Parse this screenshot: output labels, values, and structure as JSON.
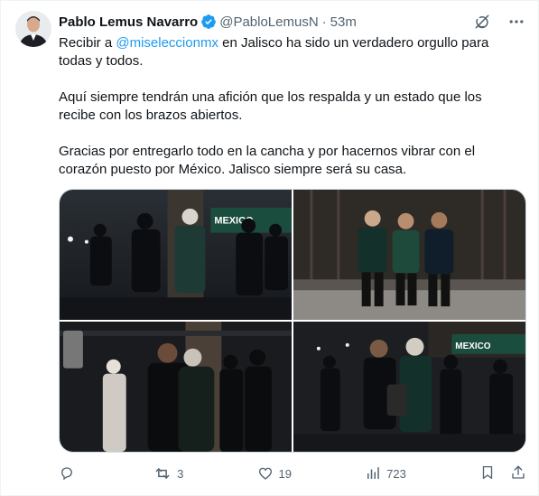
{
  "author": {
    "name": "Pablo Lemus Navarro",
    "handle": "@PabloLemusN",
    "separator": "·",
    "time": "53m"
  },
  "tweet": {
    "p1_before": "Recibir a ",
    "p1_mention": "@miseleccionmx",
    "p1_after": " en Jalisco ha sido un verdadero orgullo para todas y todos.",
    "p2": "Aquí siempre tendrán una afición que los respalda y un estado que los recibe con los brazos abiertos.",
    "p3": "Gracias por entregarlo todo en la cancha y por hacernos vibrar con el corazón puesto por México. Jalisco siempre será su casa."
  },
  "media": {
    "banner_text": "MEXICO"
  },
  "actions": {
    "replies": "",
    "retweets": "3",
    "likes": "19",
    "views": "723"
  },
  "colors": {
    "accent": "#1d9bf0",
    "muted": "#536471",
    "text": "#0f1419"
  },
  "icons": {
    "verified": "verified-badge-icon",
    "grok": "grok-icon",
    "more": "more-icon",
    "reply": "reply-icon",
    "retweet": "retweet-icon",
    "like": "heart-icon",
    "views": "views-chart-icon",
    "bookmark": "bookmark-icon",
    "share": "share-icon"
  }
}
